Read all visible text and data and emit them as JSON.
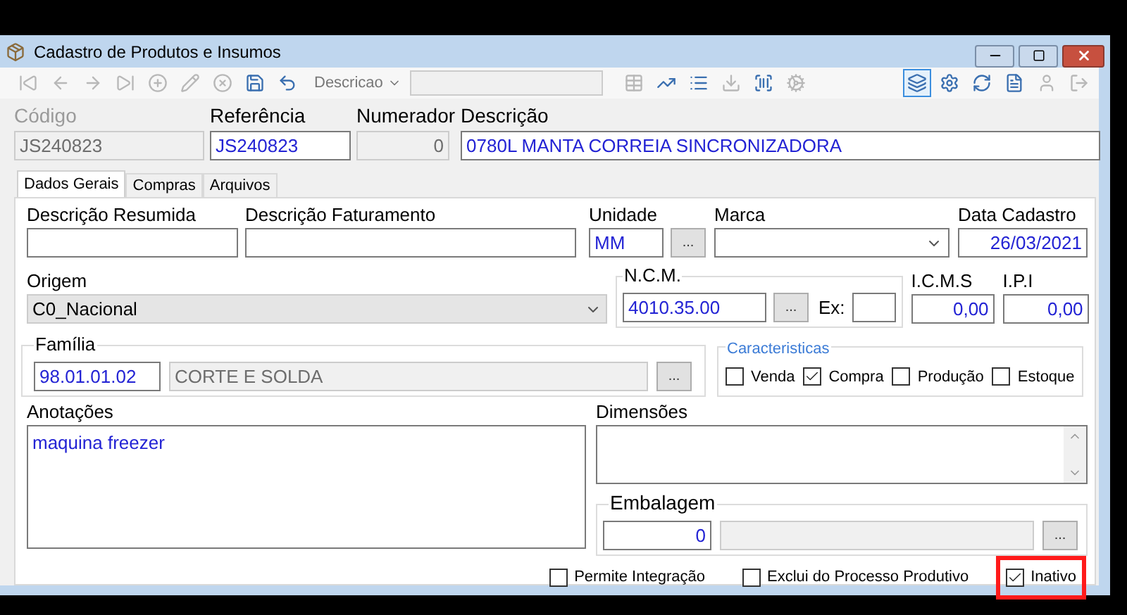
{
  "window": {
    "title": "Cadastro de Produtos e Insumos"
  },
  "toolbar": {
    "left": [
      {
        "disabled": true
      },
      {
        "disabled": true
      },
      {
        "disabled": true
      },
      {
        "disabled": true
      },
      {
        "disabled": true
      },
      {
        "disabled": true
      },
      {
        "disabled": true
      },
      {
        "disabled": false
      },
      {
        "disabled": false
      }
    ],
    "search": {
      "label": "Descricao"
    },
    "middle": [
      {
        "disabled": true
      },
      {
        "disabled": false
      },
      {
        "disabled": false
      },
      {
        "disabled": true
      },
      {
        "disabled": false
      },
      {
        "disabled": true
      }
    ],
    "right": [
      {
        "selected": true,
        "disabled": false
      },
      {
        "selected": false,
        "disabled": false
      },
      {
        "selected": false,
        "disabled": false
      },
      {
        "selected": false,
        "disabled": false
      },
      {
        "selected": false,
        "disabled": true
      },
      {
        "selected": false,
        "disabled": true
      }
    ]
  },
  "header": [
    {
      "label": "Código",
      "value": "JS240823",
      "disabled": true
    },
    {
      "label": "Referência",
      "value": "JS240823",
      "disabled": false
    },
    {
      "label": "Numerador",
      "value": "0",
      "disabled": true
    },
    {
      "label": "Descrição",
      "value": "0780L MANTA CORREIA SINCRONIZADORA",
      "disabled": false
    }
  ],
  "tabs": [
    {
      "label": "Dados Gerais",
      "selected": true
    },
    {
      "label": "Compras",
      "selected": false
    },
    {
      "label": "Arquivos",
      "selected": false
    }
  ],
  "descricao_resumida": {
    "label": "Descrição Resumida"
  },
  "descricao_faturamento": {
    "label": "Descrição Faturamento"
  },
  "unidade": {
    "label": "Unidade",
    "value": "MM",
    "button": "..."
  },
  "marca": {
    "label": "Marca"
  },
  "data_cadastro": {
    "label": "Data Cadastro",
    "value": "26/03/2021"
  },
  "origem": {
    "label": "Origem",
    "value": "C0_Nacional"
  },
  "ncm": {
    "label": "N.C.M.",
    "value": "4010.35.00",
    "button": "...",
    "ex_label": "Ex:"
  },
  "icms": {
    "label": "I.C.M.S",
    "value": "0,00"
  },
  "ipi": {
    "label": "I.P.I",
    "value": "0,00"
  },
  "familia": {
    "label": "Família",
    "code": "98.01.01.02",
    "name": "CORTE E SOLDA",
    "button": "..."
  },
  "caracteristicas": {
    "label": "Caracteristicas",
    "items": [
      {
        "label": "Venda",
        "checked": false
      },
      {
        "label": "Compra",
        "checked": true
      },
      {
        "label": "Produção",
        "checked": false
      },
      {
        "label": "Estoque",
        "checked": false
      }
    ]
  },
  "anotacoes": {
    "label": "Anotações",
    "value": "maquina freezer"
  },
  "dimensoes": {
    "label": "Dimensões"
  },
  "embalagem": {
    "label": "Embalagem",
    "value": "0",
    "button": "..."
  },
  "options": [
    {
      "kind": "plain",
      "label": "Permite Integração",
      "checked": false
    },
    {
      "kind": "plain",
      "label": "Exclui do Processo Produtivo",
      "checked": false
    },
    {
      "kind": "highlighted",
      "label": "Inativo",
      "checked": true
    }
  ]
}
